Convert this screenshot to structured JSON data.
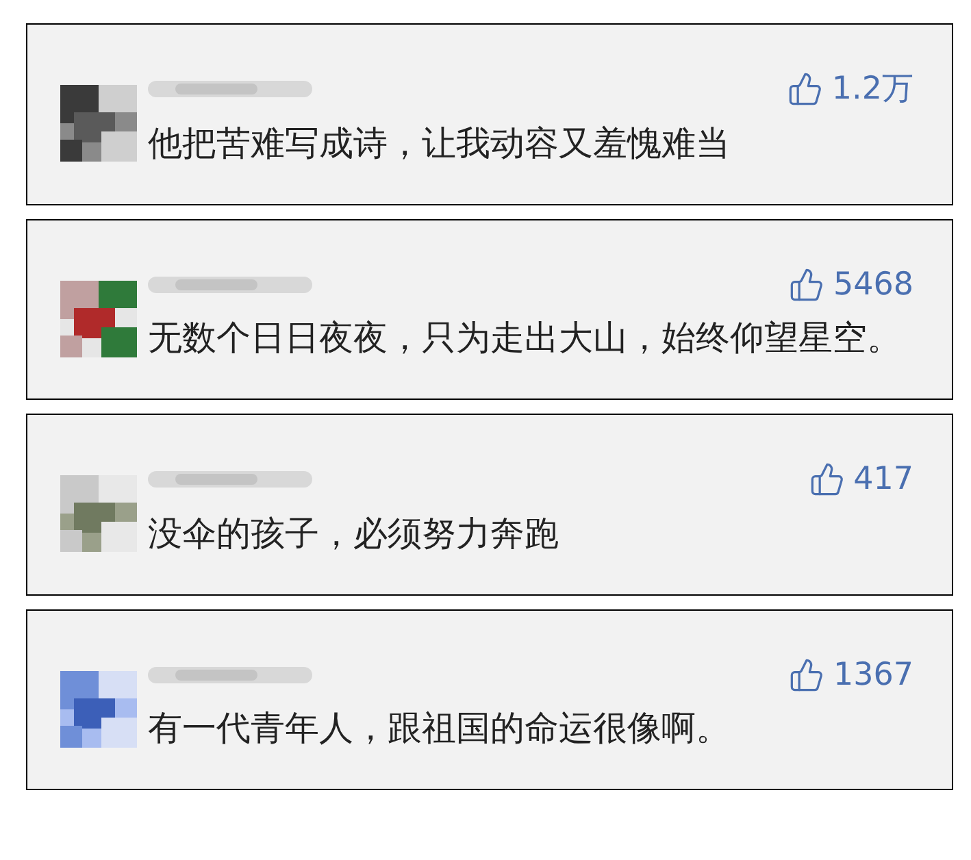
{
  "comments": [
    {
      "likes": "1.2万",
      "text": "他把苦难写成诗，让我动容又羞愧难当"
    },
    {
      "likes": "5468",
      "text": "无数个日日夜夜，只为走出大山，始终仰望星空。"
    },
    {
      "likes": "417",
      "text": "没伞的孩子，必须努力奔跑"
    },
    {
      "likes": "1367",
      "text": "有一代青年人，跟祖国的命运很像啊。"
    }
  ]
}
